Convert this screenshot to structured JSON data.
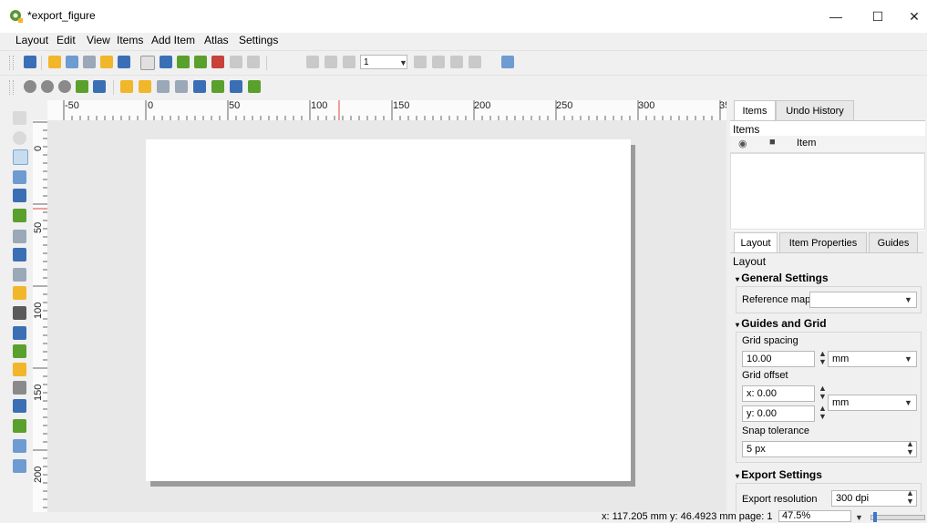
{
  "window": {
    "title": "*export_figure",
    "minimize_glyph": "—",
    "maximize_glyph": "☐",
    "close_glyph": "✕"
  },
  "menu": [
    "Layout",
    "Edit",
    "View",
    "Items",
    "Add Item",
    "Atlas",
    "Settings"
  ],
  "toolbar": {
    "page_number": "1"
  },
  "ruler": {
    "h_labels": [
      "-50",
      "0",
      "50",
      "100",
      "150",
      "200",
      "250",
      "300",
      "35"
    ],
    "v_labels": [
      "0",
      "50",
      "100",
      "150",
      "200"
    ]
  },
  "items_panel": {
    "tabs": [
      "Items",
      "Undo History"
    ],
    "heading": "Items",
    "column_item": "Item"
  },
  "layout_panel": {
    "tabs": [
      "Layout",
      "Item Properties",
      "Guides"
    ],
    "heading": "Layout",
    "general_settings": "General Settings",
    "reference_map_label": "Reference map",
    "reference_map_value": "",
    "guides_and_grid": "Guides and Grid",
    "grid_spacing_label": "Grid spacing",
    "grid_spacing_value": "10.00",
    "grid_spacing_unit": "mm",
    "grid_offset_label": "Grid offset",
    "grid_offset_x": "x: 0.00",
    "grid_offset_y": "y: 0.00",
    "grid_offset_unit": "mm",
    "snap_tolerance_label": "Snap tolerance",
    "snap_tolerance_value": "5 px",
    "export_settings": "Export Settings",
    "export_resolution_label": "Export resolution",
    "export_resolution_value": "300 dpi"
  },
  "status": {
    "coords": "x: 117.205 mm y: 46.4923 mm page: 1",
    "zoom": "47.5%"
  },
  "colors": {
    "qgis_green": "#589632",
    "icon_blue": "#3a6fb5",
    "icon_yellow": "#f2b62a",
    "icon_green": "#5aa02c",
    "icon_red": "#c8413a"
  }
}
